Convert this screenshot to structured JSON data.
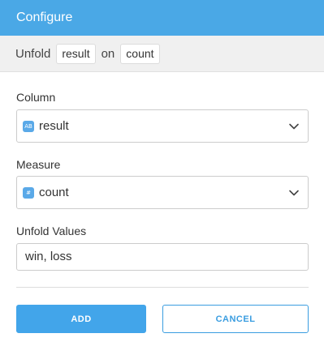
{
  "header": {
    "title": "Configure"
  },
  "summary": {
    "prefix": "Unfold",
    "column_chip": "result",
    "connector": "on",
    "measure_chip": "count"
  },
  "column": {
    "label": "Column",
    "type_icon": "AB",
    "value": "result"
  },
  "measure": {
    "label": "Measure",
    "type_icon": "#",
    "value": "count"
  },
  "unfold_values": {
    "label": "Unfold Values",
    "value": "win, loss"
  },
  "buttons": {
    "add": "ADD",
    "cancel": "CANCEL"
  },
  "colors": {
    "accent": "#4aa8e6",
    "button": "#42a5ea",
    "badge": "#5aa9e8"
  }
}
